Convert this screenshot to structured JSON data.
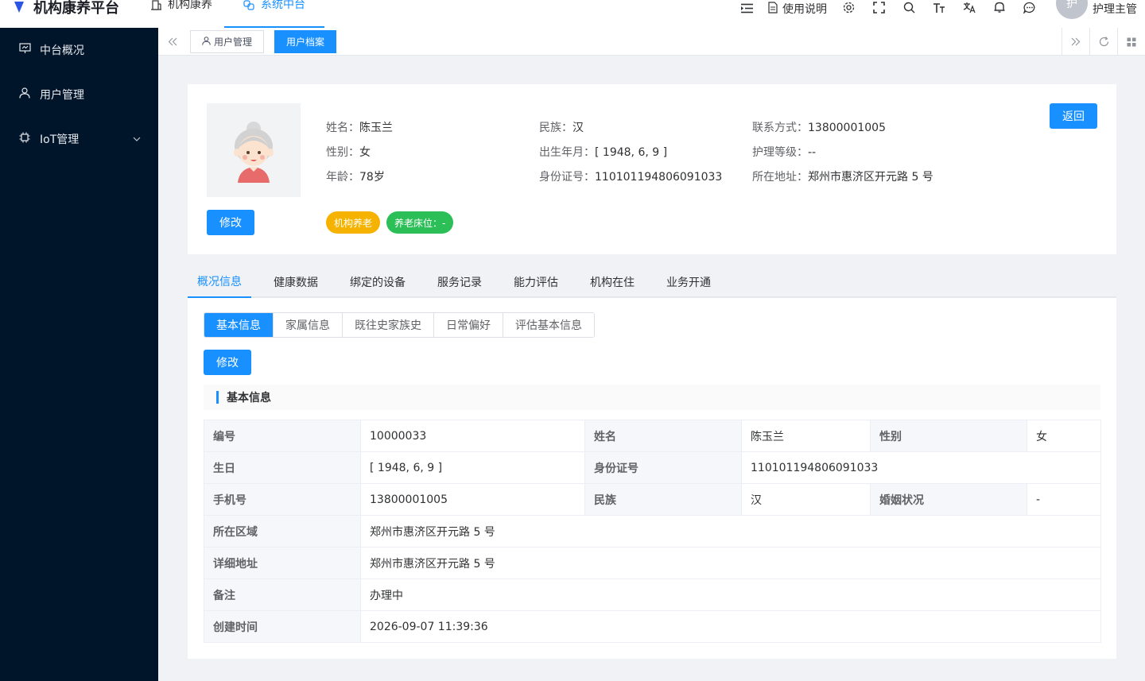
{
  "app": {
    "title": "机构康养平台"
  },
  "topnav": [
    {
      "label": "机构康养",
      "icon": "building-icon"
    },
    {
      "label": "系统中台",
      "icon": "link-icon"
    }
  ],
  "header": {
    "doc_label": "使用说明",
    "avatar_text": "护",
    "user_name": "护理主管"
  },
  "sidebar": {
    "items": [
      {
        "label": "中台概况",
        "icon": "dashboard-icon"
      },
      {
        "label": "用户管理",
        "icon": "user-icon"
      },
      {
        "label": "IoT管理",
        "icon": "chip-icon"
      }
    ]
  },
  "tags": [
    {
      "label": "用户管理"
    },
    {
      "label": "用户档案"
    }
  ],
  "profile": {
    "name_label": "姓名：",
    "name": "陈玉兰",
    "gender_label": "性别：",
    "gender": "女",
    "age_label": "年龄：",
    "age": "78岁",
    "ethnicity_label": "民族：",
    "ethnicity": "汉",
    "birth_label": "出生年月：",
    "birth": "[ 1948, 6, 9 ]",
    "id_label": "身份证号：",
    "id": "110101194806091033",
    "phone_label": "联系方式：",
    "phone": "13800001005",
    "care_label": "护理等级：",
    "care": "--",
    "addr_label": "所在地址：",
    "addr": "郑州市惠济区开元路 5 号",
    "edit_label": "修改",
    "back_label": "返回",
    "badges": [
      "机构养老",
      "养老床位：-"
    ]
  },
  "tabs": [
    "概况信息",
    "健康数据",
    "绑定的设备",
    "服务记录",
    "能力评估",
    "机构在住",
    "业务开通"
  ],
  "subtabs": [
    "基本信息",
    "家属信息",
    "既往史家族史",
    "日常偏好",
    "评估基本信息"
  ],
  "detail": {
    "edit_label": "修改",
    "section_title": "基本信息",
    "rows": {
      "code_l": "编号",
      "code": "10000033",
      "name_l": "姓名",
      "name": "陈玉兰",
      "gender_l": "性别",
      "gender": "女",
      "birth_l": "生日",
      "birth": "[ 1948, 6, 9 ]",
      "id_l": "身份证号",
      "id": "110101194806091033",
      "phone_l": "手机号",
      "phone": "13800001005",
      "eth_l": "民族",
      "eth": "汉",
      "marital_l": "婚姻状况",
      "marital": "-",
      "area_l": "所在区域",
      "area": "郑州市惠济区开元路 5 号",
      "addr_l": "详细地址",
      "addr": "郑州市惠济区开元路 5 号",
      "remark_l": "备注",
      "remark": "办理中",
      "created_l": "创建时间",
      "created": "2026-09-07 11:39:36"
    }
  },
  "colors": {
    "primary": "#1890ff",
    "sidebar": "#001529",
    "gold": "#f5b300",
    "green": "#2dbf57"
  }
}
